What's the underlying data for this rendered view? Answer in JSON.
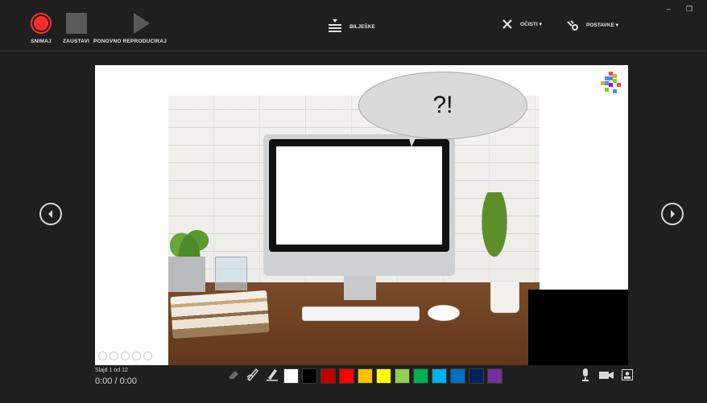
{
  "toolbar": {
    "record_label": "SNIMAJ",
    "stop_label": "ZAUSTAVI",
    "replay_label": "PONOVNO REPRODUCIRAJ",
    "notes_label": "BILJEŠKE",
    "clear_label": "OČISTI ▾",
    "settings_label": "POSTAVKE ▾"
  },
  "window": {
    "minimize": "–",
    "restore": "❐"
  },
  "slide": {
    "bubble_text": "?!"
  },
  "status": {
    "slide_count": "Slajd 1 od 12",
    "timer": "0:00 / 0:00"
  },
  "colors": {
    "accent_record": "#ff2d2d",
    "palette": [
      "#ffffff",
      "#000000",
      "#c00000",
      "#ff0000",
      "#ffc000",
      "#ffff00",
      "#92d050",
      "#00b050",
      "#00b0f0",
      "#0070c0",
      "#002060",
      "#7030a0"
    ]
  },
  "icons": {
    "record": "record-icon",
    "stop": "stop-icon",
    "replay": "play-icon",
    "notes": "notes-icon",
    "clear": "close-icon",
    "settings": "settings-icon",
    "prev": "chevron-left-icon",
    "next": "chevron-right-icon",
    "eraser": "eraser-icon",
    "pen": "pen-icon",
    "highlighter": "highlighter-icon",
    "mic": "microphone-icon",
    "camera": "camera-icon",
    "camera_preview": "camera-preview-icon"
  }
}
